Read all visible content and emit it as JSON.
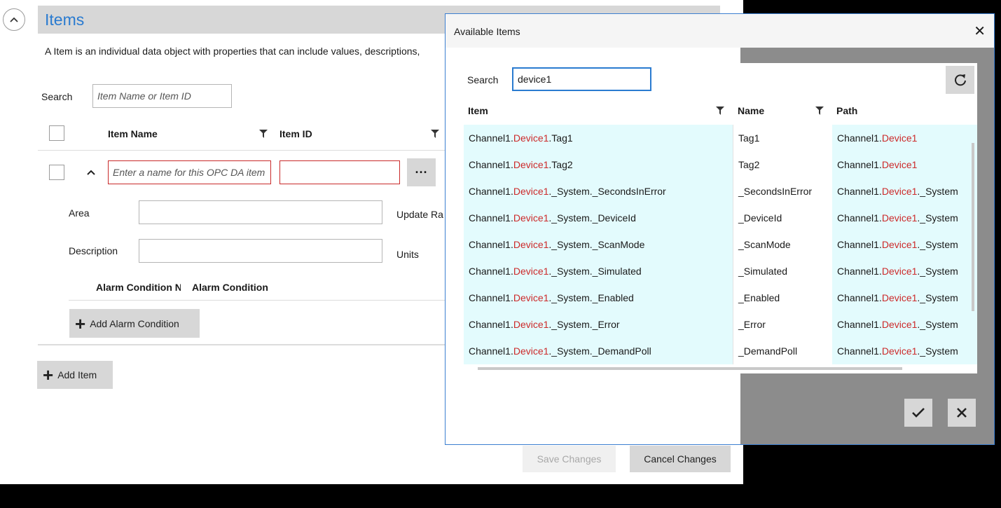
{
  "items_section": {
    "title": "Items",
    "description": "A Item is an individual data object with properties that can include values, descriptions,",
    "search_label": "Search",
    "search_placeholder": "Item Name or Item ID",
    "columns": {
      "item_name": "Item Name",
      "item_id": "Item ID"
    },
    "row": {
      "name_placeholder": "Enter a name for this OPC DA item",
      "item_id_value": "",
      "browse_label": "···",
      "area_label": "Area",
      "area_value": "",
      "update_rate_label": "Update Ra",
      "description_label": "Description",
      "description_value": "",
      "units_label": "Units",
      "alarm_columns": {
        "name": "Alarm Condition N",
        "condition": "Alarm Condition"
      },
      "add_alarm_label": "Add Alarm Condition"
    },
    "add_item_label": "Add Item",
    "save_label": "Save Changes",
    "cancel_label": "Cancel Changes"
  },
  "dialog": {
    "title": "Available Items",
    "close_glyph": "✕",
    "search_label": "Search",
    "search_value": "device1",
    "columns": {
      "item": "Item",
      "name": "Name",
      "path": "Path"
    },
    "rows": [
      {
        "item_pre": "Channel1.",
        "item_hl": "Device1",
        "item_post": ".Tag1",
        "name": "Tag1",
        "path_pre": "Channel1.",
        "path_hl": "Device1",
        "path_post": ""
      },
      {
        "item_pre": "Channel1.",
        "item_hl": "Device1",
        "item_post": ".Tag2",
        "name": "Tag2",
        "path_pre": "Channel1.",
        "path_hl": "Device1",
        "path_post": ""
      },
      {
        "item_pre": "Channel1.",
        "item_hl": "Device1",
        "item_post": "._System._SecondsInError",
        "name": "_SecondsInError",
        "path_pre": "Channel1.",
        "path_hl": "Device1",
        "path_post": "._System"
      },
      {
        "item_pre": "Channel1.",
        "item_hl": "Device1",
        "item_post": "._System._DeviceId",
        "name": "_DeviceId",
        "path_pre": "Channel1.",
        "path_hl": "Device1",
        "path_post": "._System"
      },
      {
        "item_pre": "Channel1.",
        "item_hl": "Device1",
        "item_post": "._System._ScanMode",
        "name": "_ScanMode",
        "path_pre": "Channel1.",
        "path_hl": "Device1",
        "path_post": "._System"
      },
      {
        "item_pre": "Channel1.",
        "item_hl": "Device1",
        "item_post": "._System._Simulated",
        "name": "_Simulated",
        "path_pre": "Channel1.",
        "path_hl": "Device1",
        "path_post": "._System"
      },
      {
        "item_pre": "Channel1.",
        "item_hl": "Device1",
        "item_post": "._System._Enabled",
        "name": "_Enabled",
        "path_pre": "Channel1.",
        "path_hl": "Device1",
        "path_post": "._System"
      },
      {
        "item_pre": "Channel1.",
        "item_hl": "Device1",
        "item_post": "._System._Error",
        "name": "_Error",
        "path_pre": "Channel1.",
        "path_hl": "Device1",
        "path_post": "._System"
      },
      {
        "item_pre": "Channel1.",
        "item_hl": "Device1",
        "item_post": "._System._DemandPoll",
        "name": "_DemandPoll",
        "path_pre": "Channel1.",
        "path_hl": "Device1",
        "path_post": "._System"
      }
    ],
    "ok_icon": "checkmark-icon",
    "cancel_icon": "close-icon",
    "refresh_icon": "refresh-icon"
  },
  "colors": {
    "accent": "#2a7bd0",
    "highlight": "#cc2a2a",
    "row_tint": "#e3fbfd",
    "dialog_border": "#3c7fd0"
  }
}
